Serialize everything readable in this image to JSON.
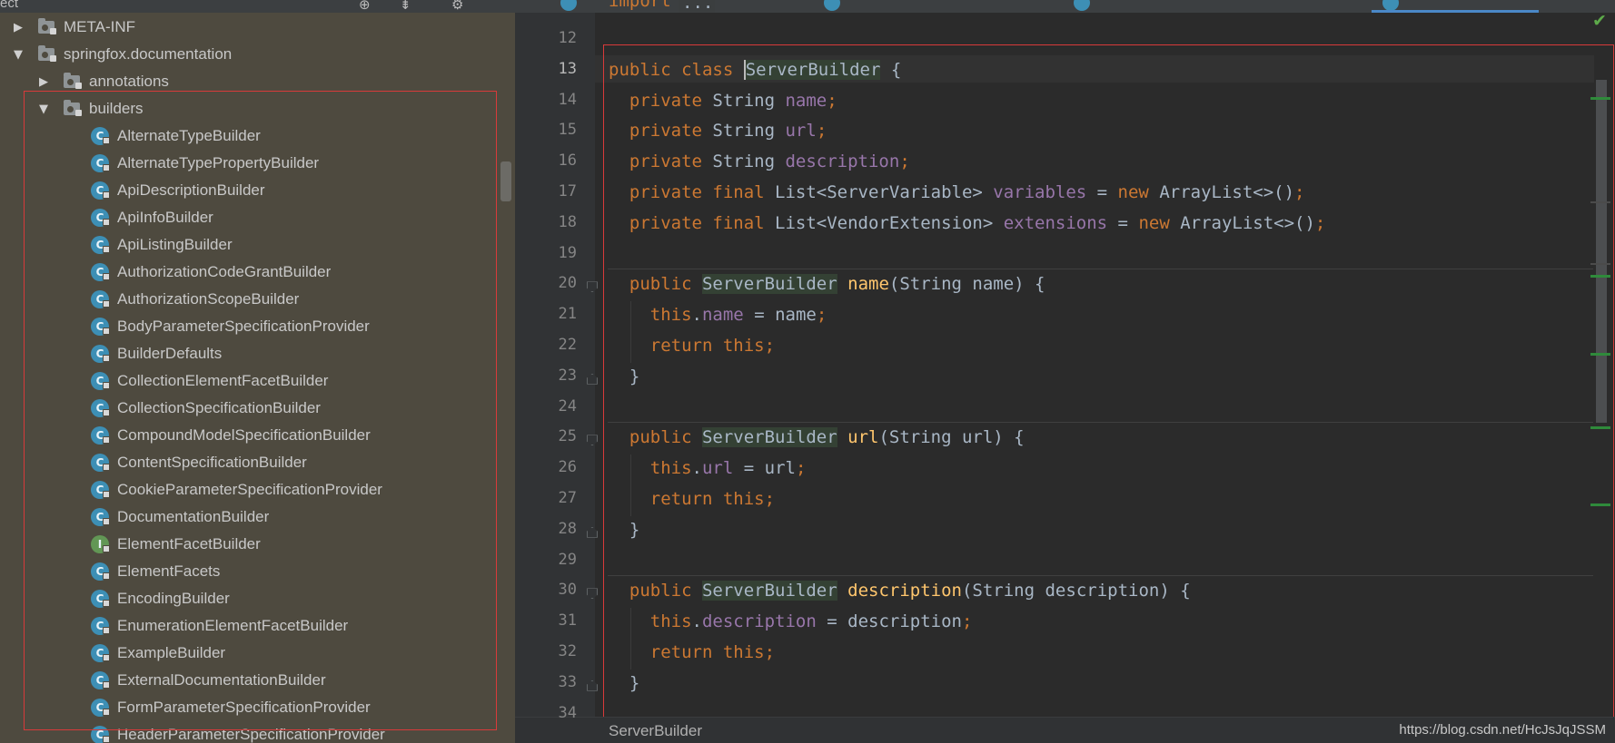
{
  "project_panel": {
    "header_label": "ect",
    "tree": [
      {
        "label": "META-INF",
        "kind": "package",
        "expanded": false,
        "depth": 0
      },
      {
        "label": "springfox.documentation",
        "kind": "package",
        "expanded": true,
        "depth": 0
      },
      {
        "label": "annotations",
        "kind": "package",
        "expanded": false,
        "depth": 1
      },
      {
        "label": "builders",
        "kind": "package",
        "expanded": true,
        "depth": 1
      },
      {
        "label": "AlternateTypeBuilder",
        "kind": "class",
        "depth": 2
      },
      {
        "label": "AlternateTypePropertyBuilder",
        "kind": "class",
        "depth": 2
      },
      {
        "label": "ApiDescriptionBuilder",
        "kind": "class",
        "depth": 2
      },
      {
        "label": "ApiInfoBuilder",
        "kind": "class",
        "depth": 2
      },
      {
        "label": "ApiListingBuilder",
        "kind": "class",
        "depth": 2
      },
      {
        "label": "AuthorizationCodeGrantBuilder",
        "kind": "class",
        "depth": 2
      },
      {
        "label": "AuthorizationScopeBuilder",
        "kind": "class",
        "depth": 2
      },
      {
        "label": "BodyParameterSpecificationProvider",
        "kind": "class",
        "depth": 2
      },
      {
        "label": "BuilderDefaults",
        "kind": "class",
        "depth": 2
      },
      {
        "label": "CollectionElementFacetBuilder",
        "kind": "class",
        "depth": 2
      },
      {
        "label": "CollectionSpecificationBuilder",
        "kind": "class",
        "depth": 2
      },
      {
        "label": "CompoundModelSpecificationBuilder",
        "kind": "class",
        "depth": 2
      },
      {
        "label": "ContentSpecificationBuilder",
        "kind": "class",
        "depth": 2
      },
      {
        "label": "CookieParameterSpecificationProvider",
        "kind": "class",
        "depth": 2
      },
      {
        "label": "DocumentationBuilder",
        "kind": "class",
        "depth": 2
      },
      {
        "label": "ElementFacetBuilder",
        "kind": "interface",
        "depth": 2
      },
      {
        "label": "ElementFacets",
        "kind": "class",
        "depth": 2
      },
      {
        "label": "EncodingBuilder",
        "kind": "class",
        "depth": 2
      },
      {
        "label": "EnumerationElementFacetBuilder",
        "kind": "class",
        "depth": 2
      },
      {
        "label": "ExampleBuilder",
        "kind": "class",
        "depth": 2
      },
      {
        "label": "ExternalDocumentationBuilder",
        "kind": "class",
        "depth": 2
      },
      {
        "label": "FormParameterSpecificationProvider",
        "kind": "class",
        "depth": 2
      },
      {
        "label": "HeaderParameterSpecificationProvider",
        "kind": "class",
        "depth": 2
      }
    ],
    "icon_glyphs": {
      "class": "C",
      "interface": "I"
    }
  },
  "editor": {
    "folded_import": {
      "keyword": "import",
      "placeholder": "..."
    },
    "lines": [
      {
        "no": "12",
        "html": []
      },
      {
        "no": "13",
        "current": true,
        "html": [
          [
            "kw",
            "public class "
          ],
          [
            "caret-hl",
            "ServerBuilder"
          ],
          [
            "p",
            " {"
          ]
        ]
      },
      {
        "no": "14",
        "html": [
          [
            "p",
            "  "
          ],
          [
            "kw",
            "private "
          ],
          [
            "p",
            "String "
          ],
          [
            "fld",
            "name"
          ],
          [
            "kw",
            ";"
          ]
        ]
      },
      {
        "no": "15",
        "html": [
          [
            "p",
            "  "
          ],
          [
            "kw",
            "private "
          ],
          [
            "p",
            "String "
          ],
          [
            "fld",
            "url"
          ],
          [
            "kw",
            ";"
          ]
        ]
      },
      {
        "no": "16",
        "html": [
          [
            "p",
            "  "
          ],
          [
            "kw",
            "private "
          ],
          [
            "p",
            "String "
          ],
          [
            "fld",
            "description"
          ],
          [
            "kw",
            ";"
          ]
        ]
      },
      {
        "no": "17",
        "html": [
          [
            "p",
            "  "
          ],
          [
            "kw",
            "private final "
          ],
          [
            "p",
            "List<ServerVariable> "
          ],
          [
            "fld",
            "variables"
          ],
          [
            "p",
            " = "
          ],
          [
            "kw",
            "new "
          ],
          [
            "p",
            "ArrayList<>()"
          ],
          [
            "kw",
            ";"
          ]
        ]
      },
      {
        "no": "18",
        "html": [
          [
            "p",
            "  "
          ],
          [
            "kw",
            "private final "
          ],
          [
            "p",
            "List<VendorExtension> "
          ],
          [
            "fld",
            "extensions"
          ],
          [
            "p",
            " = "
          ],
          [
            "kw",
            "new "
          ],
          [
            "p",
            "ArrayList<>()"
          ],
          [
            "kw",
            ";"
          ]
        ]
      },
      {
        "no": "19",
        "html": []
      },
      {
        "no": "20",
        "html": [
          [
            "p",
            "  "
          ],
          [
            "kw",
            "public "
          ],
          [
            "hl",
            "ServerBuilder"
          ],
          [
            "p",
            " "
          ],
          [
            "fn",
            "name"
          ],
          [
            "p",
            "(String name) {"
          ]
        ]
      },
      {
        "no": "21",
        "html": [
          [
            "p",
            "    "
          ],
          [
            "kw",
            "this"
          ],
          [
            "p",
            "."
          ],
          [
            "fld",
            "name"
          ],
          [
            "p",
            " = name"
          ],
          [
            "kw",
            ";"
          ]
        ]
      },
      {
        "no": "22",
        "html": [
          [
            "p",
            "    "
          ],
          [
            "kw",
            "return this;"
          ]
        ]
      },
      {
        "no": "23",
        "html": [
          [
            "p",
            "  }"
          ]
        ]
      },
      {
        "no": "24",
        "html": []
      },
      {
        "no": "25",
        "html": [
          [
            "p",
            "  "
          ],
          [
            "kw",
            "public "
          ],
          [
            "hl",
            "ServerBuilder"
          ],
          [
            "p",
            " "
          ],
          [
            "fn",
            "url"
          ],
          [
            "p",
            "(String url) {"
          ]
        ]
      },
      {
        "no": "26",
        "html": [
          [
            "p",
            "    "
          ],
          [
            "kw",
            "this"
          ],
          [
            "p",
            "."
          ],
          [
            "fld",
            "url"
          ],
          [
            "p",
            " = url"
          ],
          [
            "kw",
            ";"
          ]
        ]
      },
      {
        "no": "27",
        "html": [
          [
            "p",
            "    "
          ],
          [
            "kw",
            "return this;"
          ]
        ]
      },
      {
        "no": "28",
        "html": [
          [
            "p",
            "  }"
          ]
        ]
      },
      {
        "no": "29",
        "html": []
      },
      {
        "no": "30",
        "html": [
          [
            "p",
            "  "
          ],
          [
            "kw",
            "public "
          ],
          [
            "hl",
            "ServerBuilder"
          ],
          [
            "p",
            " "
          ],
          [
            "fn",
            "description"
          ],
          [
            "p",
            "(String description) {"
          ]
        ]
      },
      {
        "no": "31",
        "html": [
          [
            "p",
            "    "
          ],
          [
            "kw",
            "this"
          ],
          [
            "p",
            "."
          ],
          [
            "fld",
            "description"
          ],
          [
            "p",
            " = description"
          ],
          [
            "kw",
            ";"
          ]
        ]
      },
      {
        "no": "32",
        "html": [
          [
            "p",
            "    "
          ],
          [
            "kw",
            "return this;"
          ]
        ]
      },
      {
        "no": "33",
        "html": [
          [
            "p",
            "  }"
          ]
        ]
      },
      {
        "no": "34",
        "html": []
      }
    ],
    "breadcrumb": "ServerBuilder",
    "inspection_icon": "checkmark-icon"
  },
  "watermark": "https://blog.csdn.net/HcJsJqJSSM",
  "colors": {
    "keyword": "#cc7832",
    "field": "#9876aa",
    "method": "#ffc66d",
    "plain": "#a9b7c6",
    "highlight_bg": "#344134",
    "annotation_box": "#d83a3a"
  }
}
